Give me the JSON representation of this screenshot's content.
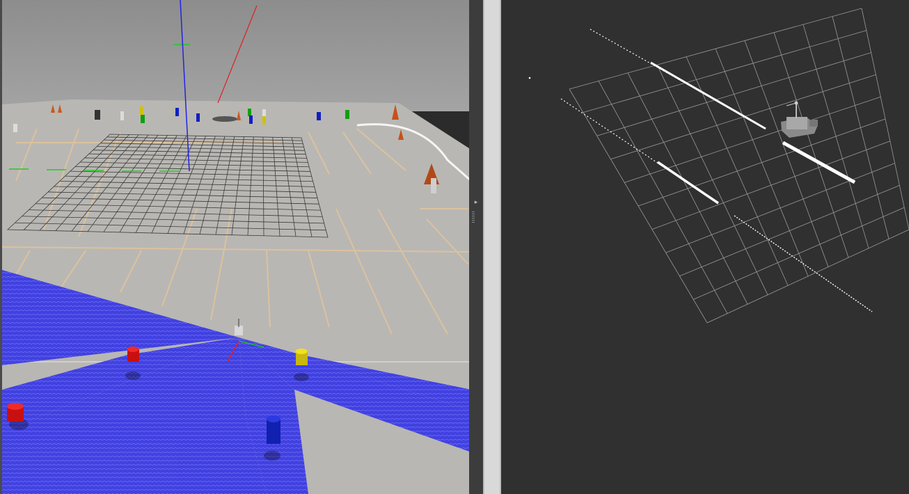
{
  "gazebo_view": {
    "sky_color": "#979797",
    "ground_color": "#b8b6b2",
    "parking_line_color": "#e0c39a",
    "laser_color": "#2a2ae0",
    "axes": {
      "x": "#e02020",
      "y": "#20c020",
      "z": "#2020e0"
    },
    "cylinders": [
      "#d01010",
      "#d01010",
      "#d0c010",
      "#1020c0"
    ]
  },
  "splitter": {
    "collapse_icon": "triangle-right"
  },
  "rviz_view": {
    "background": "#303030",
    "grid_color": "#a0a0a0",
    "scan_color": "#ffffff",
    "robot_color": "#9a9a9a"
  }
}
